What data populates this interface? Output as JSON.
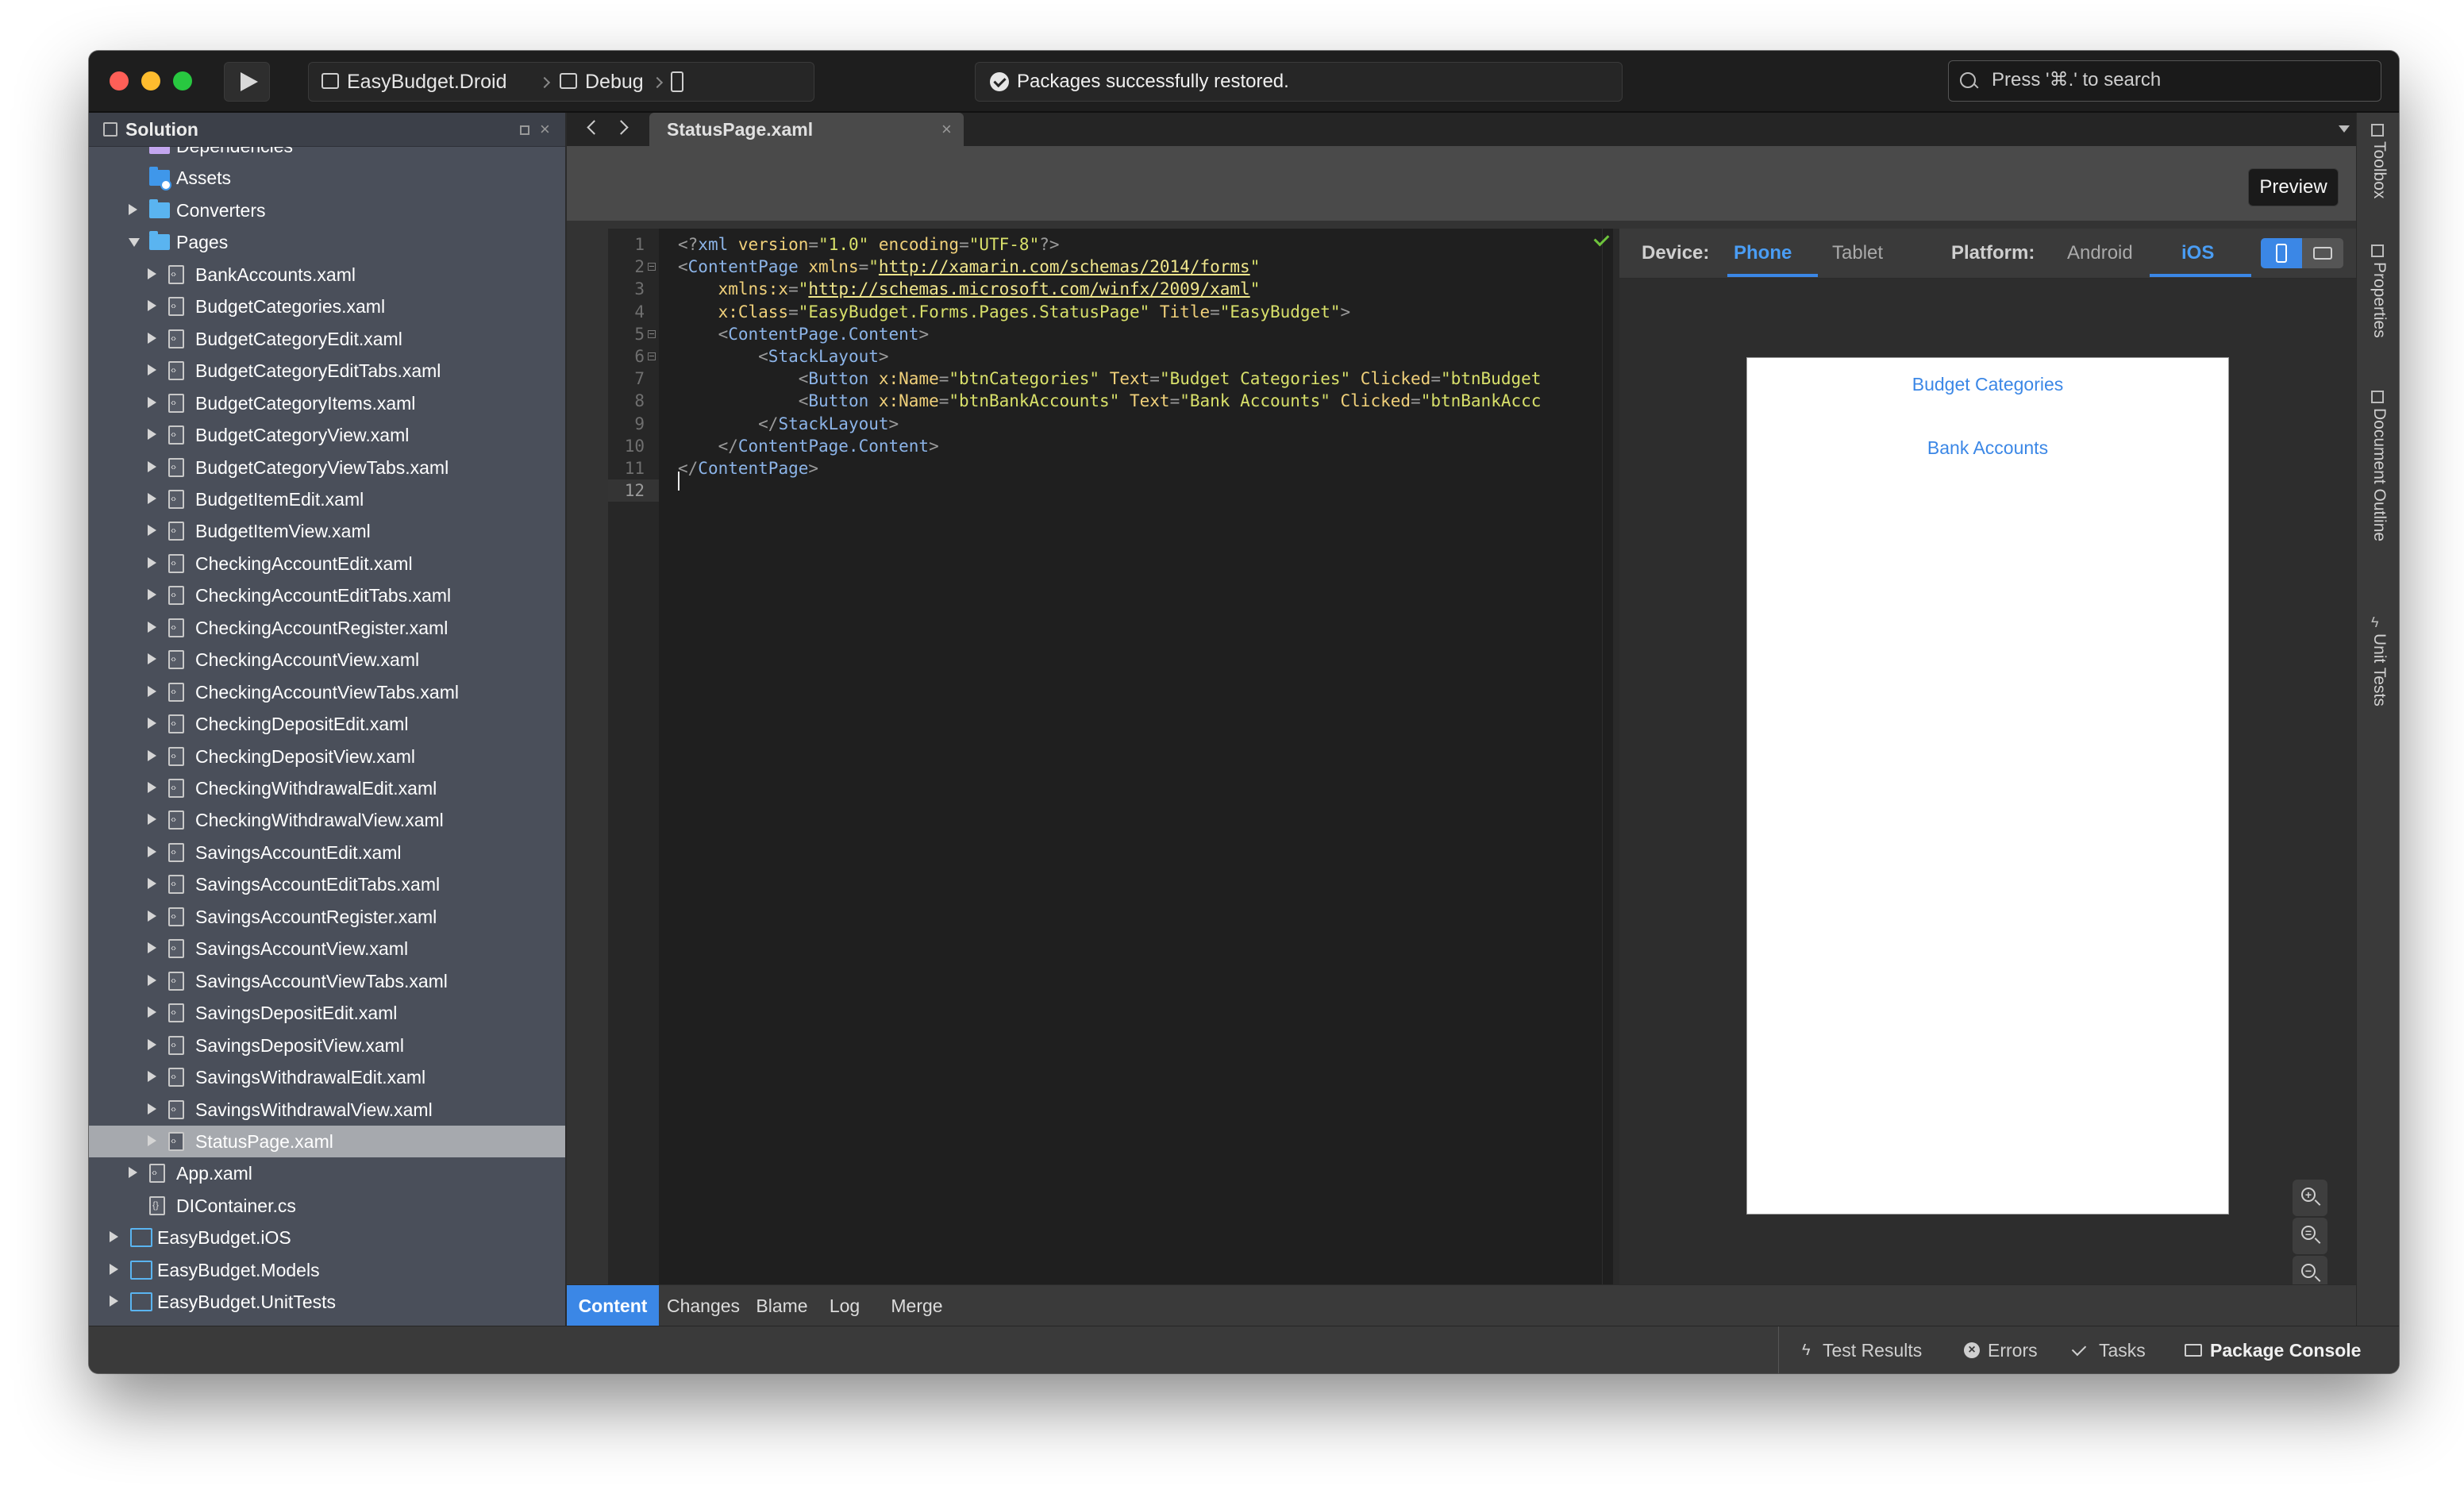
{
  "toolbar": {
    "project_label": "EasyBudget.Droid",
    "config_label": "Debug",
    "status_text": "Packages successfully restored.",
    "search_placeholder": "Press '⌘.' to search"
  },
  "solution_pad": {
    "title": "Solution",
    "items": [
      {
        "label": "Dependencies",
        "depth": 2,
        "icon": "references-icon",
        "twisty": "none"
      },
      {
        "label": "Assets",
        "depth": 2,
        "icon": "assets-folder-icon",
        "twisty": "none"
      },
      {
        "label": "Converters",
        "depth": 2,
        "icon": "folder-icon",
        "twisty": "closed"
      },
      {
        "label": "Pages",
        "depth": 2,
        "icon": "folder-icon",
        "twisty": "open"
      },
      {
        "label": "BankAccounts.xaml",
        "depth": 3,
        "icon": "xaml-file-icon",
        "twisty": "closed"
      },
      {
        "label": "BudgetCategories.xaml",
        "depth": 3,
        "icon": "xaml-file-icon",
        "twisty": "closed"
      },
      {
        "label": "BudgetCategoryEdit.xaml",
        "depth": 3,
        "icon": "xaml-file-icon",
        "twisty": "closed"
      },
      {
        "label": "BudgetCategoryEditTabs.xaml",
        "depth": 3,
        "icon": "xaml-file-icon",
        "twisty": "closed"
      },
      {
        "label": "BudgetCategoryItems.xaml",
        "depth": 3,
        "icon": "xaml-file-icon",
        "twisty": "closed"
      },
      {
        "label": "BudgetCategoryView.xaml",
        "depth": 3,
        "icon": "xaml-file-icon",
        "twisty": "closed"
      },
      {
        "label": "BudgetCategoryViewTabs.xaml",
        "depth": 3,
        "icon": "xaml-file-icon",
        "twisty": "closed"
      },
      {
        "label": "BudgetItemEdit.xaml",
        "depth": 3,
        "icon": "xaml-file-icon",
        "twisty": "closed"
      },
      {
        "label": "BudgetItemView.xaml",
        "depth": 3,
        "icon": "xaml-file-icon",
        "twisty": "closed"
      },
      {
        "label": "CheckingAccountEdit.xaml",
        "depth": 3,
        "icon": "xaml-file-icon",
        "twisty": "closed"
      },
      {
        "label": "CheckingAccountEditTabs.xaml",
        "depth": 3,
        "icon": "xaml-file-icon",
        "twisty": "closed"
      },
      {
        "label": "CheckingAccountRegister.xaml",
        "depth": 3,
        "icon": "xaml-file-icon",
        "twisty": "closed"
      },
      {
        "label": "CheckingAccountView.xaml",
        "depth": 3,
        "icon": "xaml-file-icon",
        "twisty": "closed"
      },
      {
        "label": "CheckingAccountViewTabs.xaml",
        "depth": 3,
        "icon": "xaml-file-icon",
        "twisty": "closed"
      },
      {
        "label": "CheckingDepositEdit.xaml",
        "depth": 3,
        "icon": "xaml-file-icon",
        "twisty": "closed"
      },
      {
        "label": "CheckingDepositView.xaml",
        "depth": 3,
        "icon": "xaml-file-icon",
        "twisty": "closed"
      },
      {
        "label": "CheckingWithdrawalEdit.xaml",
        "depth": 3,
        "icon": "xaml-file-icon",
        "twisty": "closed"
      },
      {
        "label": "CheckingWithdrawalView.xaml",
        "depth": 3,
        "icon": "xaml-file-icon",
        "twisty": "closed"
      },
      {
        "label": "SavingsAccountEdit.xaml",
        "depth": 3,
        "icon": "xaml-file-icon",
        "twisty": "closed"
      },
      {
        "label": "SavingsAccountEditTabs.xaml",
        "depth": 3,
        "icon": "xaml-file-icon",
        "twisty": "closed"
      },
      {
        "label": "SavingsAccountRegister.xaml",
        "depth": 3,
        "icon": "xaml-file-icon",
        "twisty": "closed"
      },
      {
        "label": "SavingsAccountView.xaml",
        "depth": 3,
        "icon": "xaml-file-icon",
        "twisty": "closed"
      },
      {
        "label": "SavingsAccountViewTabs.xaml",
        "depth": 3,
        "icon": "xaml-file-icon",
        "twisty": "closed"
      },
      {
        "label": "SavingsDepositEdit.xaml",
        "depth": 3,
        "icon": "xaml-file-icon",
        "twisty": "closed"
      },
      {
        "label": "SavingsDepositView.xaml",
        "depth": 3,
        "icon": "xaml-file-icon",
        "twisty": "closed"
      },
      {
        "label": "SavingsWithdrawalEdit.xaml",
        "depth": 3,
        "icon": "xaml-file-icon",
        "twisty": "closed"
      },
      {
        "label": "SavingsWithdrawalView.xaml",
        "depth": 3,
        "icon": "xaml-file-icon",
        "twisty": "closed"
      },
      {
        "label": "StatusPage.xaml",
        "depth": 3,
        "icon": "xaml-file-icon",
        "twisty": "closed",
        "selected": true
      },
      {
        "label": "App.xaml",
        "depth": 2,
        "icon": "xaml-file-icon",
        "twisty": "closed"
      },
      {
        "label": "DIContainer.cs",
        "depth": 2,
        "icon": "cs-file-icon",
        "twisty": "none"
      },
      {
        "label": "EasyBudget.iOS",
        "depth": 1,
        "icon": "project-icon",
        "twisty": "closed"
      },
      {
        "label": "EasyBudget.Models",
        "depth": 1,
        "icon": "project-icon",
        "twisty": "closed"
      },
      {
        "label": "EasyBudget.UnitTests",
        "depth": 1,
        "icon": "project-icon",
        "twisty": "closed"
      }
    ]
  },
  "editor": {
    "tab_label": "StatusPage.xaml",
    "preview_label": "Preview",
    "line_numbers": [
      "1",
      "2",
      "3",
      "4",
      "5",
      "6",
      "7",
      "8",
      "9",
      "10",
      "11",
      "12"
    ],
    "lines": [
      [
        [
          "p",
          "<?"
        ],
        [
          "t",
          "xml"
        ],
        [
          "a",
          " version"
        ],
        [
          "p",
          "="
        ],
        [
          "v",
          "\"1.0\""
        ],
        [
          "a",
          " encoding"
        ],
        [
          "p",
          "="
        ],
        [
          "v",
          "\"UTF-8\""
        ],
        [
          "p",
          "?>"
        ]
      ],
      [
        [
          "p",
          "<"
        ],
        [
          "t",
          "ContentPage"
        ],
        [
          "a",
          " xmlns"
        ],
        [
          "p",
          "="
        ],
        [
          "v",
          "\""
        ],
        [
          "u",
          "http://xamarin.com/schemas/2014/forms"
        ],
        [
          "v",
          "\""
        ]
      ],
      [
        [
          "a",
          "    xmlns:x"
        ],
        [
          "p",
          "="
        ],
        [
          "v",
          "\""
        ],
        [
          "u",
          "http://schemas.microsoft.com/winfx/2009/xaml"
        ],
        [
          "v",
          "\""
        ]
      ],
      [
        [
          "a",
          "    x:Class"
        ],
        [
          "p",
          "="
        ],
        [
          "v",
          "\"EasyBudget.Forms.Pages.StatusPage\""
        ],
        [
          "a",
          " Title"
        ],
        [
          "p",
          "="
        ],
        [
          "v",
          "\"EasyBudget\""
        ],
        [
          "p",
          ">"
        ]
      ],
      [
        [
          "p",
          "    <"
        ],
        [
          "t",
          "ContentPage.Content"
        ],
        [
          "p",
          ">"
        ]
      ],
      [
        [
          "p",
          "        <"
        ],
        [
          "t",
          "StackLayout"
        ],
        [
          "p",
          ">"
        ]
      ],
      [
        [
          "p",
          "            <"
        ],
        [
          "t",
          "Button"
        ],
        [
          "a",
          " x:Name"
        ],
        [
          "p",
          "="
        ],
        [
          "v",
          "\"btnCategories\""
        ],
        [
          "a",
          " Text"
        ],
        [
          "p",
          "="
        ],
        [
          "v",
          "\"Budget Categories\""
        ],
        [
          "a",
          " Clicked"
        ],
        [
          "p",
          "="
        ],
        [
          "v",
          "\"btnBudget"
        ]
      ],
      [
        [
          "p",
          "            <"
        ],
        [
          "t",
          "Button"
        ],
        [
          "a",
          " x:Name"
        ],
        [
          "p",
          "="
        ],
        [
          "v",
          "\"btnBankAccounts\""
        ],
        [
          "a",
          " Text"
        ],
        [
          "p",
          "="
        ],
        [
          "v",
          "\"Bank Accounts\""
        ],
        [
          "a",
          " Clicked"
        ],
        [
          "p",
          "="
        ],
        [
          "v",
          "\"btnBankAccc"
        ]
      ],
      [
        [
          "p",
          "        </"
        ],
        [
          "t",
          "StackLayout"
        ],
        [
          "p",
          ">"
        ]
      ],
      [
        [
          "p",
          "    </"
        ],
        [
          "t",
          "ContentPage.Content"
        ],
        [
          "p",
          ">"
        ]
      ],
      [
        [
          "p",
          "</"
        ],
        [
          "t",
          "ContentPage"
        ],
        [
          "p",
          ">"
        ]
      ],
      [
        [
          "p",
          ""
        ]
      ]
    ]
  },
  "previewer": {
    "device_label": "Device:",
    "phone": "Phone",
    "tablet": "Tablet",
    "platform_label": "Platform:",
    "android": "Android",
    "ios": "iOS",
    "buttons": [
      "Budget Categories",
      "Bank Accounts"
    ]
  },
  "editor_tabs": [
    "Content",
    "Changes",
    "Blame",
    "Log",
    "Merge"
  ],
  "side_pads": [
    "Toolbox",
    "Properties",
    "Document Outline",
    "Unit Tests"
  ],
  "bottom_bar": {
    "test_results": "Test Results",
    "errors": "Errors",
    "tasks": "Tasks",
    "package_console": "Package Console"
  },
  "colors": {
    "accent": "#3b87e6",
    "selection": "#a6a9ae",
    "pad_background": "#4a4f5a",
    "editor_background": "#1f1f1f"
  }
}
